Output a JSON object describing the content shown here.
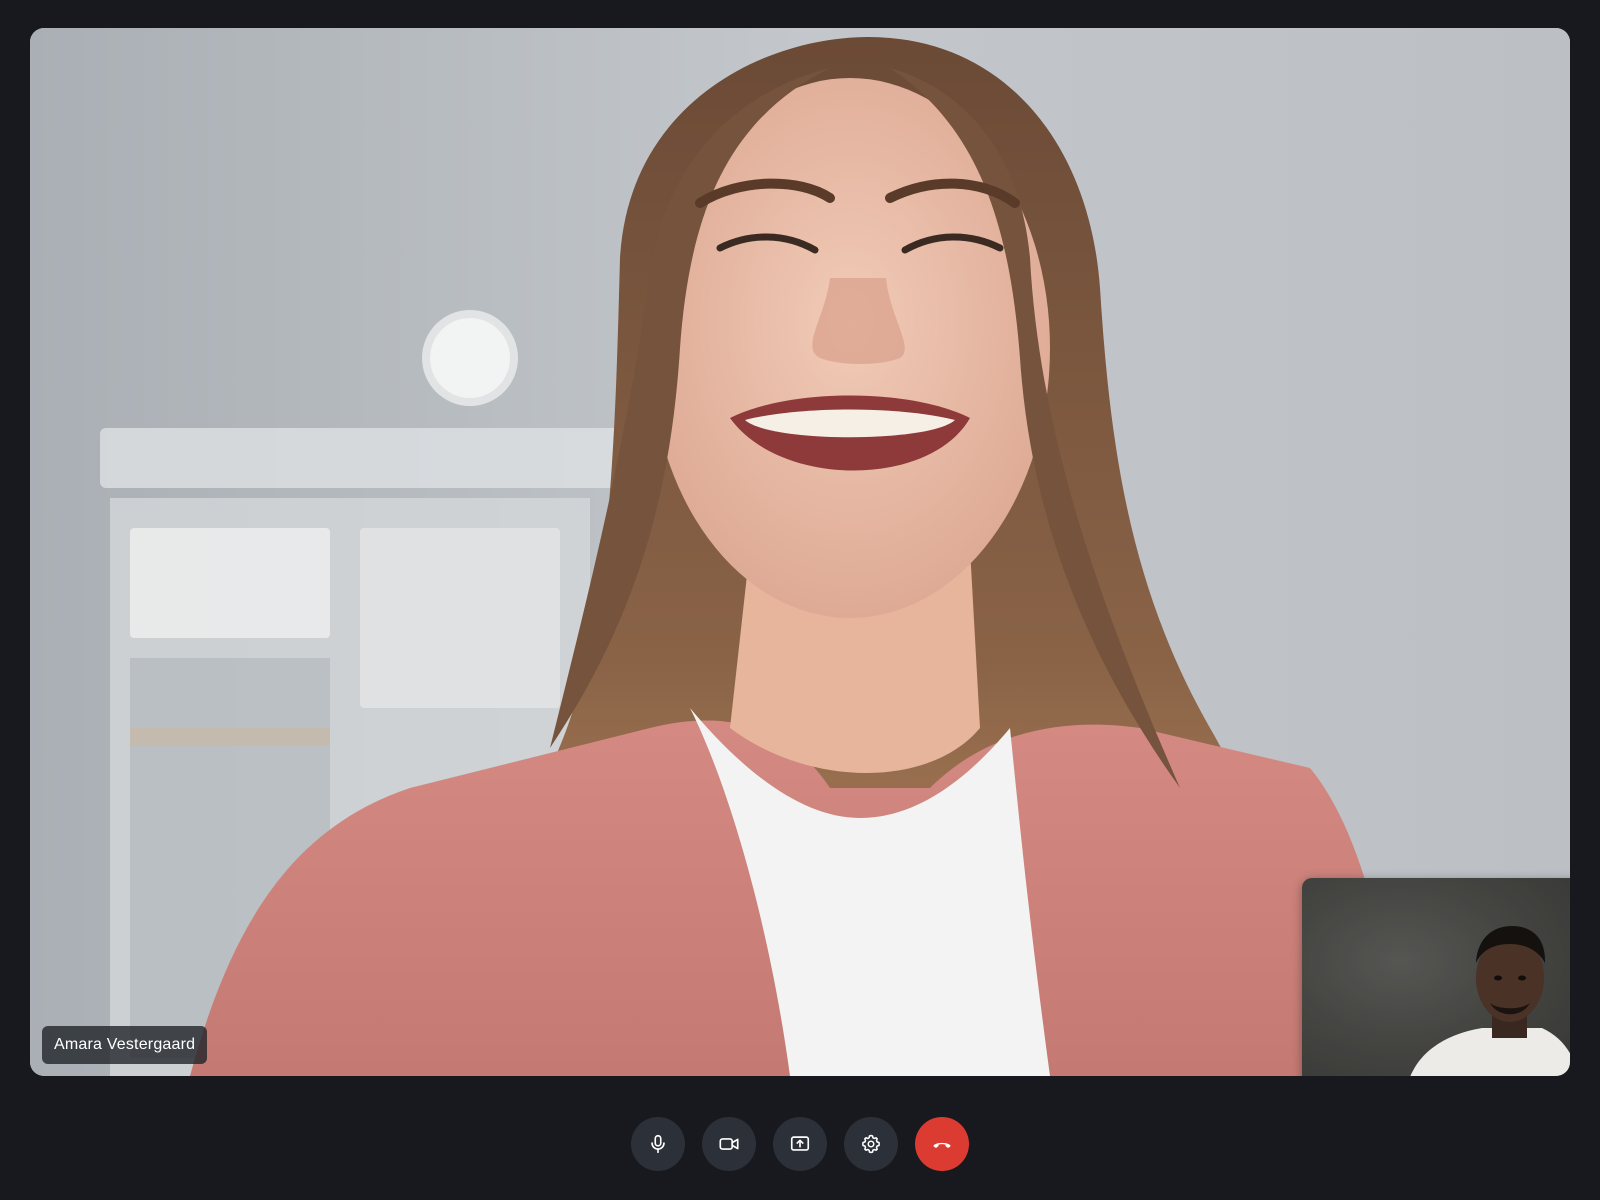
{
  "participant": {
    "name": "Amara Vestergaard"
  },
  "controls": [
    {
      "id": "microphone",
      "icon": "microphone-icon"
    },
    {
      "id": "camera",
      "icon": "video-camera-icon"
    },
    {
      "id": "share-screen",
      "icon": "share-screen-icon"
    },
    {
      "id": "settings",
      "icon": "gear-icon"
    },
    {
      "id": "end-call",
      "icon": "phone-hangup-icon"
    }
  ],
  "colors": {
    "background": "#17191e",
    "control_button": "#2c3038",
    "end_call": "#dc3b31",
    "name_tag": "#1e2126"
  }
}
